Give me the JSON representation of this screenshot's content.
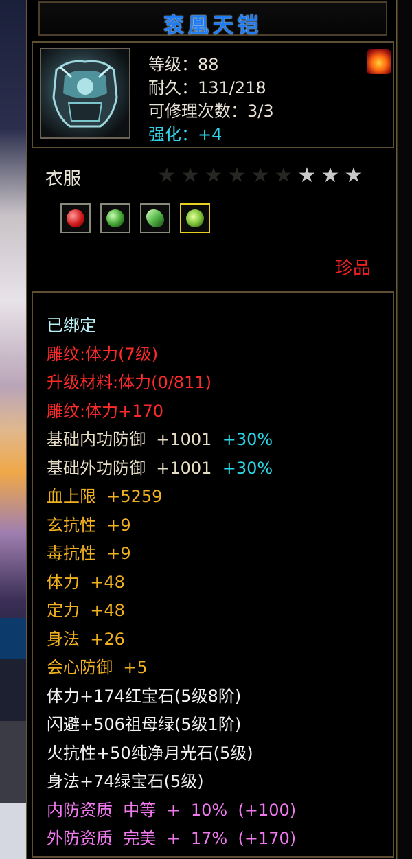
{
  "item": {
    "name": "衮凰天铠",
    "stats": {
      "level": "等级：88",
      "durability": "耐久：131/218",
      "repair": "可修理次数：3/3",
      "enhance": "强化：+4"
    },
    "type": "衣服",
    "stars_total": 9,
    "stars_lit": 3,
    "rarity": "珍品",
    "gems": [
      {
        "name": "red-gem",
        "color": "#d01818"
      },
      {
        "name": "green-jade",
        "color": "#3ea030"
      },
      {
        "name": "green-crystal",
        "color": "#56b84a"
      },
      {
        "name": "moonstone-green",
        "color": "#7cc23a"
      }
    ]
  },
  "attributes": {
    "bound": "已绑定",
    "engrave": "雕纹:体力(7级)",
    "upgrade_material": "升级材料:体力(0/811)",
    "engrave_bonus": "雕纹:体力+170",
    "inner_defense": "基础内功防御  +1001",
    "inner_defense_pct": "+30%",
    "outer_defense": "基础外功防御  +1001",
    "outer_defense_pct": "+30%",
    "hp_limit": "血上限  +5259",
    "xuan_resist": "玄抗性  +9",
    "poison_resist": "毒抗性  +9",
    "stamina": "体力  +48",
    "focus": "定力  +48",
    "agility": "身法  +26",
    "crit_defense": "会心防御  +5",
    "gem1": "体力+174红宝石(5级8阶)",
    "gem2": "闪避+506祖母绿(5级1阶)",
    "gem3": "火抗性+50纯净月光石(5级)",
    "gem4": "身法+74绿宝石(5级)",
    "inner_quality": "内防资质  中等  +  10%  (+100)",
    "outer_quality": "外防资质  完美  +  17%  (+170)"
  },
  "colors": {
    "title": "#1e7df5",
    "rare": "#f02020",
    "engrave": "#ff2a2a",
    "quality": "#f079ee",
    "gold": "#f0b020",
    "cyan": "#2fd6ea"
  }
}
